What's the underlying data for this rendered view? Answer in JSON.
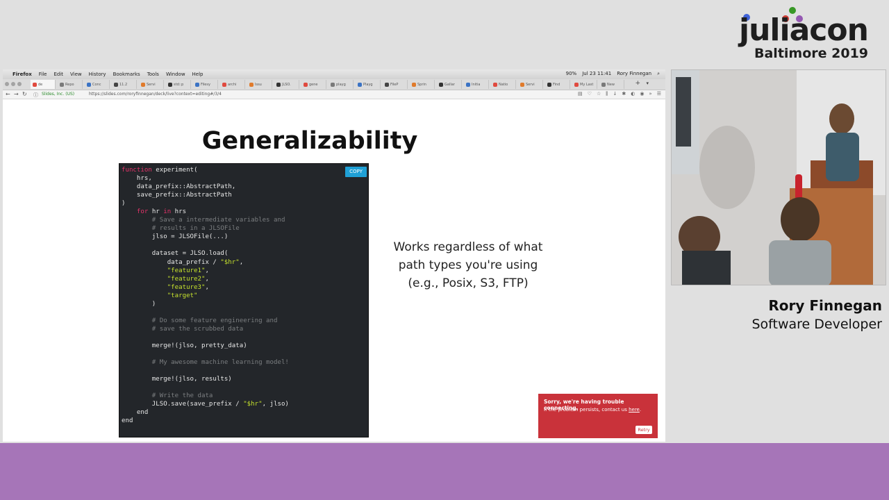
{
  "conference": {
    "logo_word": "juliacon",
    "logo_city": "Baltimore 2019",
    "dot_colors": [
      "#4063d8",
      "#389826",
      "#9558b2",
      "#cb3c33"
    ]
  },
  "browser": {
    "menu": [
      "Firefox",
      "File",
      "Edit",
      "View",
      "History",
      "Bookmarks",
      "Tools",
      "Window",
      "Help"
    ],
    "status": {
      "battery": "90%",
      "datetime": "Jul 23 11:41",
      "user": "Rory Finnegan"
    },
    "tabs": [
      "de",
      "Repo",
      "Conc",
      "11.2",
      "Servi",
      "std::p",
      "Filesy",
      "archi",
      "Issu",
      "JLSO.",
      "gene",
      "playg",
      "Playg",
      "FileP",
      "Sprin",
      "Gallar",
      "Initia",
      "Natio",
      "Servi",
      "Find",
      "My Last",
      "New"
    ],
    "site_identity": "Slides, Inc. (US)",
    "url": "https://slides.com/roryfinnegan/deck/live?context=editing#/3/4"
  },
  "slide": {
    "title": "Generalizability",
    "copy_label": "COPY",
    "code": {
      "l1_kw": "function",
      "l1": " experiment(",
      "l2": "    hrs,",
      "l3": "    data_prefix::AbstractPath,",
      "l4": "    save_prefix::AbstractPath",
      "l5": ")",
      "l6_pre": "    ",
      "l6_kw1": "for",
      "l6_mid": " hr ",
      "l6_kw2": "in",
      "l6_post": " hrs",
      "l7": "        # Save a intermediate variables and",
      "l8": "        # results in a JLSOFile",
      "l9": "        jlso = JLSOFile(...)",
      "l10": "",
      "l11": "        dataset = JLSO.load(",
      "l12_pre": "            data_prefix / ",
      "l12_str": "\"$hr\"",
      "l12_post": ",",
      "l13_pre": "            ",
      "l13_str": "\"feature1\"",
      "l13_post": ",",
      "l14_pre": "            ",
      "l14_str": "\"feature2\"",
      "l14_post": ",",
      "l15_pre": "            ",
      "l15_str": "\"feature3\"",
      "l15_post": ",",
      "l16_pre": "            ",
      "l16_str": "\"target\"",
      "l17": "        )",
      "l18": "",
      "l19": "        # Do some feature engineering and",
      "l20": "        # save the scrubbed data",
      "l21": "",
      "l22": "        merge!(jlso, pretty_data)",
      "l23": "",
      "l24": "        # My awesome machine learning model!",
      "l25": "",
      "l26": "        merge!(jlso, results)",
      "l27": "",
      "l28": "        # Write the data",
      "l29_pre": "        JLSO.save(save_prefix / ",
      "l29_str": "\"$hr\"",
      "l29_post": ", jlso)",
      "l30": "    end",
      "l31": "end"
    },
    "note_lines": [
      "Works regardless of what",
      "path types you're using",
      "(e.g., Posix, S3, FTP)"
    ]
  },
  "toast": {
    "title": "Sorry, we're having trouble connecting.",
    "body_prefix": "If the problem persists, contact us ",
    "link": "here",
    "body_suffix": ".",
    "retry": "Retry"
  },
  "speaker": {
    "name": "Rory Finnegan",
    "title": "Software Developer"
  },
  "colors": {
    "bottom_band": "#a675b8",
    "code_keyword": "#e8336b",
    "code_string": "#c4e02d",
    "toast": "#c9323a",
    "copy_button": "#1fa0d6"
  }
}
